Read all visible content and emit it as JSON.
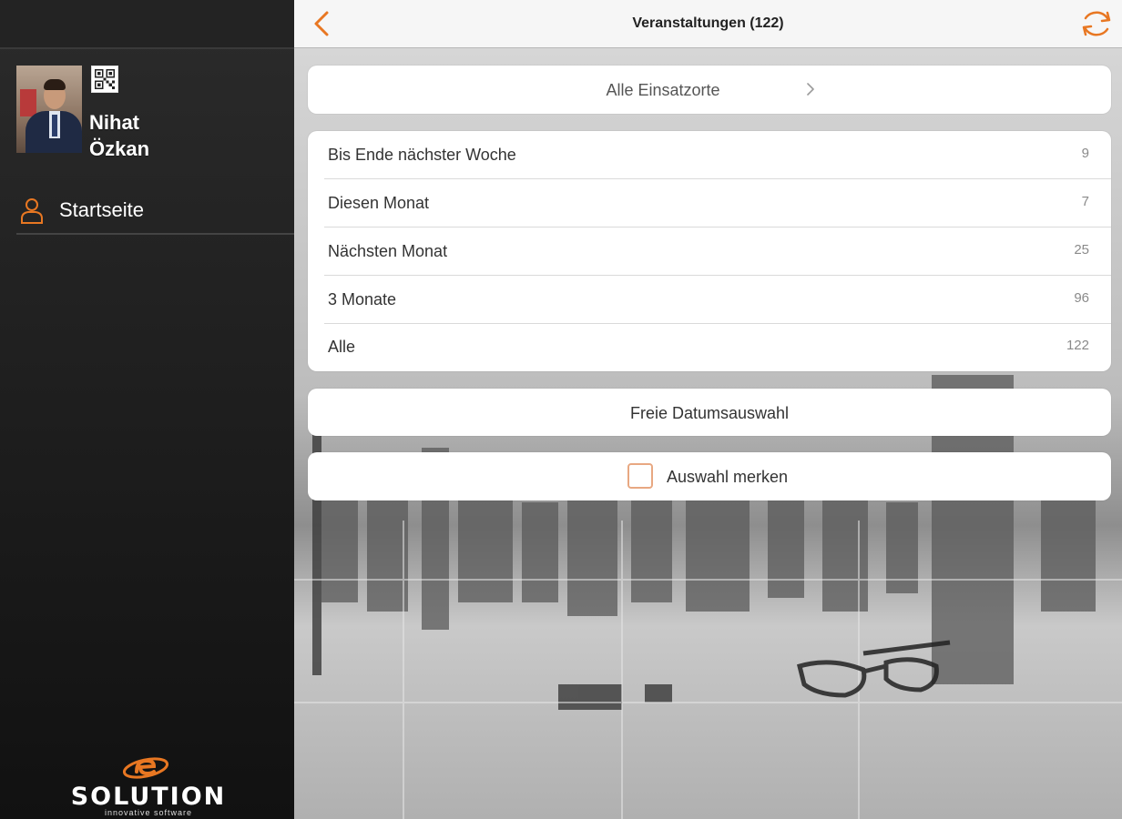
{
  "colors": {
    "accent": "#e87722",
    "sidebar_bg": "#1e1e1e",
    "navbar_bg": "#f6f6f6",
    "card_bg": "#ffffff",
    "checkbox_border": "#e8a882"
  },
  "sidebar": {
    "user": {
      "first_name": "Nihat",
      "last_name": "Özkan"
    },
    "icons": {
      "qr": "qr-code-icon",
      "home": "person-icon"
    },
    "items": [
      {
        "label": "Startseite"
      }
    ],
    "logo": {
      "word": "SOLUTION",
      "tagline": "innovative software"
    }
  },
  "navbar": {
    "title": "Veranstaltungen (122)",
    "icons": {
      "back": "chevron-left-icon",
      "refresh": "refresh-icon"
    }
  },
  "location_filter": {
    "label": "Alle Einsatzorte",
    "icon": "chevron-right-icon"
  },
  "time_filters": [
    {
      "label": "Bis Ende nächster Woche",
      "count": "9"
    },
    {
      "label": "Diesen Monat",
      "count": "7"
    },
    {
      "label": "Nächsten Monat",
      "count": "25"
    },
    {
      "label": "3 Monate",
      "count": "96"
    },
    {
      "label": "Alle",
      "count": "122"
    }
  ],
  "custom_date": {
    "label": "Freie Datumsauswahl"
  },
  "remember": {
    "label": "Auswahl merken",
    "checked": false
  }
}
